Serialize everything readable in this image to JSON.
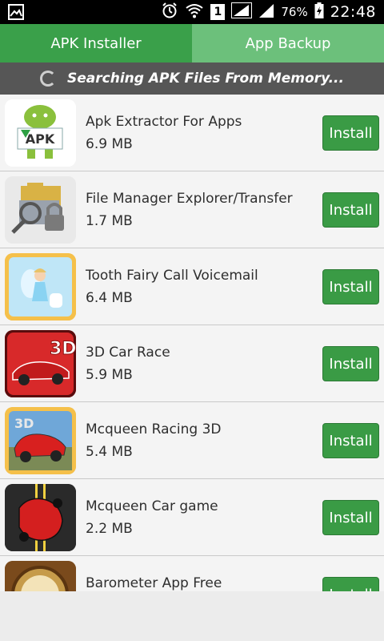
{
  "status_bar": {
    "battery": "76%",
    "time": "22:48",
    "sim_number": "1"
  },
  "tabs": [
    {
      "label": "APK Installer",
      "active": true
    },
    {
      "label": "App Backup",
      "active": false
    }
  ],
  "search_status": "Searching APK Files From Memory...",
  "apps": [
    {
      "name": "Apk Extractor For Apps",
      "size": "6.9 MB",
      "icon": "apk-extractor-icon",
      "button": "Install"
    },
    {
      "name": "File Manager Explorer/Transfer",
      "size": "1.7 MB",
      "icon": "file-manager-icon",
      "button": "Install"
    },
    {
      "name": "Tooth Fairy Call Voicemail",
      "size": "6.4 MB",
      "icon": "tooth-fairy-icon",
      "button": "Install"
    },
    {
      "name": "3D Car Race",
      "size": "5.9 MB",
      "icon": "car-race-3d-icon",
      "button": "Install"
    },
    {
      "name": "Mcqueen Racing 3D",
      "size": "5.4 MB",
      "icon": "mcqueen-racing-icon",
      "button": "Install"
    },
    {
      "name": "Mcqueen Car game",
      "size": "2.2 MB",
      "icon": "mcqueen-car-icon",
      "button": "Install"
    },
    {
      "name": "Barometer App Free",
      "size": "",
      "icon": "barometer-icon",
      "button": "Install"
    }
  ],
  "colors": {
    "tab_active": "#3aa04a",
    "tab_inactive": "#6cc07b",
    "install_button": "#3a9b45",
    "search_bar": "#565656"
  }
}
